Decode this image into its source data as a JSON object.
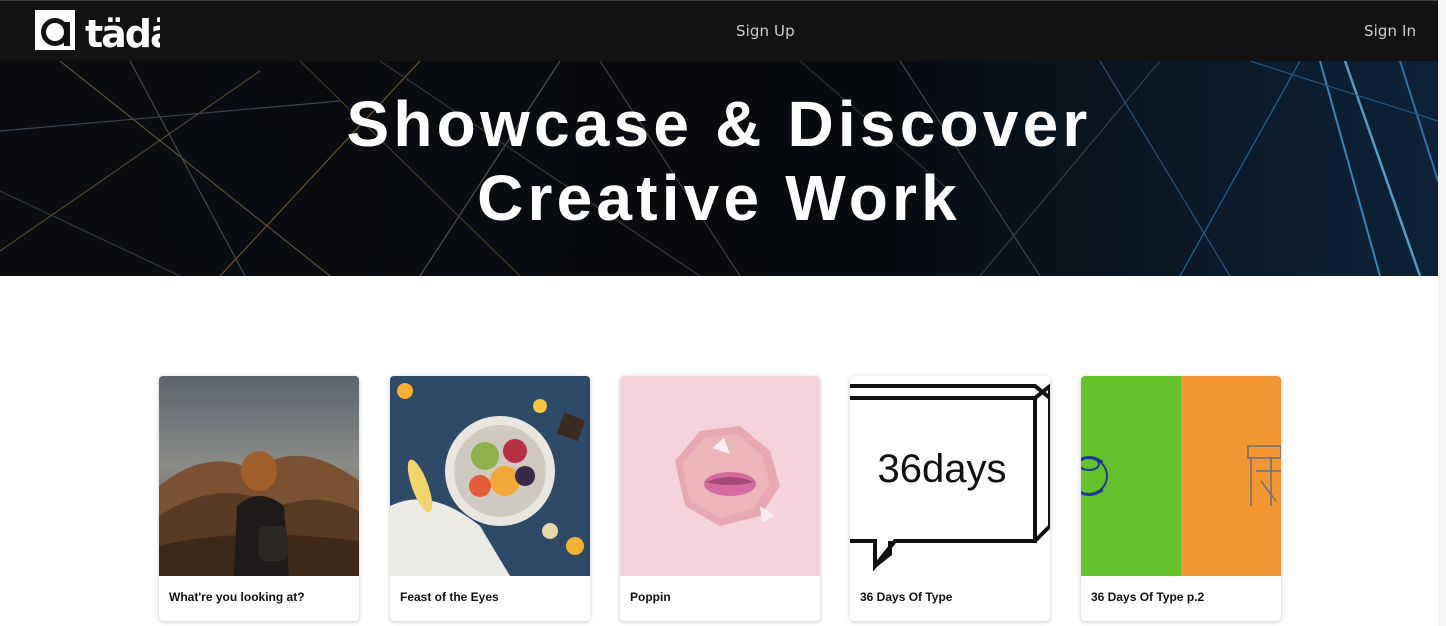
{
  "brand": {
    "name": "tädä",
    "logo_icon": "circle-a-logo-icon"
  },
  "nav": {
    "signup_label": "Sign Up",
    "signin_label": "Sign In"
  },
  "hero": {
    "title_line1": "Showcase & Discover",
    "title_line2": "Creative Work"
  },
  "cards": [
    {
      "title": "What're you looking at?",
      "image": "woman-on-hills-photo"
    },
    {
      "title": "Feast of the Eyes",
      "image": "fruit-plate-photo"
    },
    {
      "title": "Poppin",
      "image": "lips-through-paper-photo"
    },
    {
      "title": "36 Days Of Type",
      "image": "36days-lettering",
      "image_text": "36days"
    },
    {
      "title": "36 Days Of Type p.2",
      "image": "green-orange-type-art"
    }
  ],
  "colors": {
    "navbar": "#121212",
    "hero_bg": "#06090d",
    "card_text": "#111111"
  }
}
